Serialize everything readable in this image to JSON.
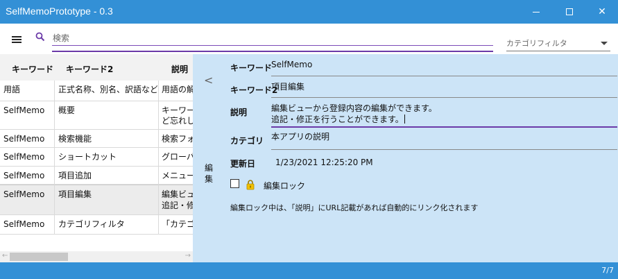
{
  "window": {
    "title": "SelfMemoPrototype - 0.3",
    "minimize_glyph": "",
    "maximize_glyph": "",
    "close_glyph": "✕"
  },
  "toolbar": {
    "search_placeholder": "検索",
    "category_filter_placeholder": "カテゴリフィルタ"
  },
  "grid": {
    "headers": [
      "キーワード",
      "キーワード2",
      "説明"
    ],
    "rows": [
      {
        "c1": "用語",
        "c2": "正式名称、別名、訳語など",
        "c3": "用語の解"
      },
      {
        "c1": "SelfMemo",
        "c2": "概要",
        "c3": "キーワード",
        "c3b": "ど忘れし"
      },
      {
        "c1": "SelfMemo",
        "c2": "検索機能",
        "c3": "検索フォ"
      },
      {
        "c1": "SelfMemo",
        "c2": "ショートカット",
        "c3": "グローバル"
      },
      {
        "c1": "SelfMemo",
        "c2": "項目追加",
        "c3": "メニューの"
      },
      {
        "c1": "SelfMemo",
        "c2": "項目編集",
        "c3": "編集ビュ",
        "c3b": "追記・修"
      },
      {
        "c1": "SelfMemo",
        "c2": "カテゴリフィルタ",
        "c3": "「カテゴリ"
      }
    ],
    "scroll_left": "←",
    "scroll_right": "→"
  },
  "editor": {
    "back_glyph": "<",
    "vertical_label": "編集",
    "fields": {
      "keyword_label": "キーワード",
      "keyword_value": "SelfMemo",
      "keyword2_label": "キーワード2",
      "keyword2_value": "項目編集",
      "description_label": "説明",
      "description_line1": "編集ビューから登録内容の編集ができます。",
      "description_line2": "追記・修正を行うことができます。",
      "category_label": "カテゴリ",
      "category_value": "本アプリの説明",
      "updated_label": "更新日",
      "updated_value": "1/23/2021 12:25:20 PM"
    },
    "lock_label": "編集ロック",
    "lock_checked": false,
    "note": "編集ロック中は、「説明」にURL記載があれば自動的にリンク化されます"
  },
  "status": {
    "count": "7/7"
  },
  "colors": {
    "accent": "#3390d6",
    "focus": "#6b3aa8",
    "panel": "#cce4f7"
  }
}
